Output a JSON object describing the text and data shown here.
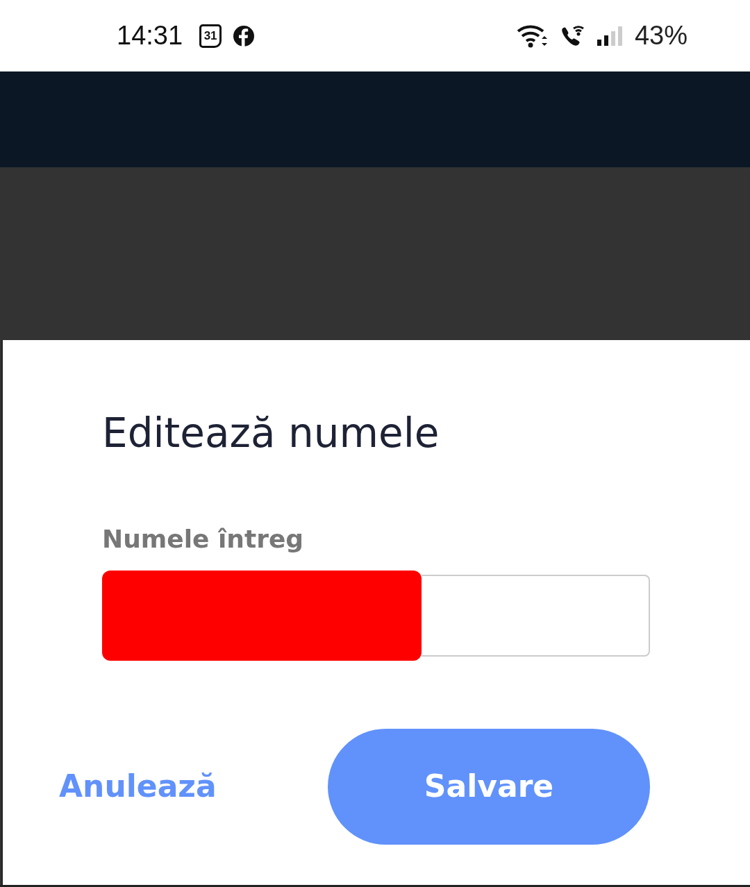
{
  "status_bar": {
    "time": "14:31",
    "calendar_day": "31",
    "battery": "43%"
  },
  "dialog": {
    "title": "Editează numele",
    "field": {
      "label": "Numele întreg",
      "value_redacted": true
    },
    "buttons": [
      {
        "label": "Anulează",
        "kind": "text"
      },
      {
        "label": "Salvare",
        "kind": "filled"
      }
    ]
  }
}
